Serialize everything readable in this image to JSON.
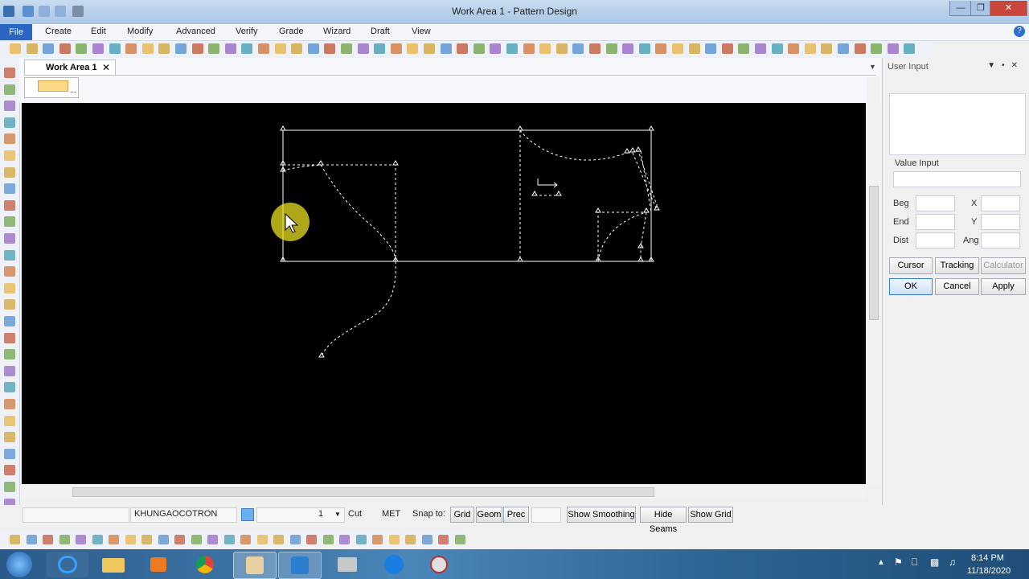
{
  "window": {
    "title": "Work Area 1 - Pattern Design"
  },
  "menu": [
    "File",
    "Create",
    "Edit",
    "Modify",
    "Advanced",
    "Verify",
    "Grade",
    "Wizard",
    "Draft",
    "View"
  ],
  "tabs": {
    "work_area": "Work Area 1"
  },
  "right_panel": {
    "title": "User Input",
    "value_input_label": "Value Input",
    "labels": {
      "beg": "Beg",
      "end": "End",
      "dist": "Dist",
      "x": "X",
      "y": "Y",
      "ang": "Ang"
    },
    "buttons": {
      "cursor": "Cursor",
      "tracking": "Tracking",
      "calculator": "Calculator",
      "ok": "OK",
      "cancel": "Cancel",
      "apply": "Apply"
    }
  },
  "status": {
    "piece_name": "KHUNGAOCOTRON",
    "quantity": "1",
    "cut_label": "Cut",
    "units": "MET",
    "snap_label": "Snap to:",
    "snap_buttons": [
      "Grid",
      "Geom",
      "Prec"
    ],
    "buttons": {
      "smoothing": "Show Smoothing",
      "seams": "Hide Seams",
      "grid": "Show Grid"
    }
  },
  "taskbar": {
    "apps": [
      "internet-explorer",
      "file-explorer",
      "media-player",
      "chrome",
      "pattern-design",
      "app-blue",
      "app-gray",
      "zalo",
      "dashboard-app"
    ],
    "time": "8:14 PM",
    "date": "11/18/2020"
  },
  "colors": {
    "accent": "#2a66c4",
    "canvas": "#000000",
    "pattern_line": "#ffffff",
    "cursor_highlight": "#e8e020"
  }
}
